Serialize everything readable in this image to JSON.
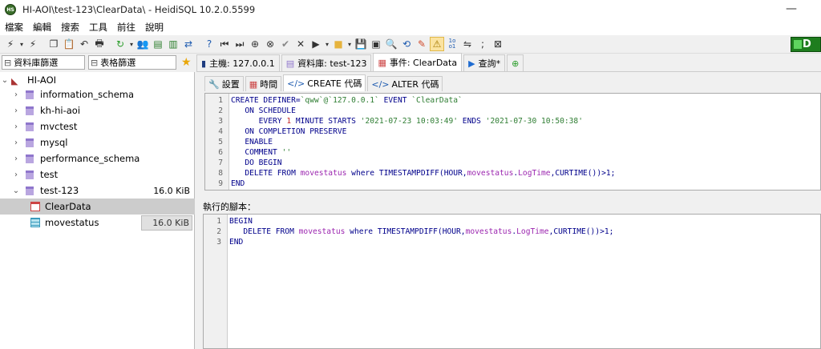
{
  "window": {
    "title": "HI-AOI\\test-123\\ClearData\\ - HeidiSQL 10.2.0.5599",
    "minimize": "—"
  },
  "menu": [
    "檔案",
    "編輯",
    "搜索",
    "工具",
    "前往",
    "說明"
  ],
  "toolbar": {
    "run_label": "D"
  },
  "filters": {
    "db_filter": "資料庫篩選",
    "table_filter": "表格篩選"
  },
  "tabs": [
    {
      "label": "主機: 127.0.0.1"
    },
    {
      "label": "資料庫: test-123"
    },
    {
      "label": "事件: ClearData"
    },
    {
      "label": "查詢*"
    }
  ],
  "tree": {
    "root": "HI-AOI",
    "databases": [
      "information_schema",
      "kh-hi-aoi",
      "mvctest",
      "mysql",
      "performance_schema",
      "test"
    ],
    "current_db": {
      "name": "test-123",
      "size": "16.0 KiB"
    },
    "items": [
      {
        "name": "ClearData",
        "type": "event",
        "size": ""
      },
      {
        "name": "movestatus",
        "type": "table",
        "size": "16.0 KiB"
      }
    ]
  },
  "subtabs": [
    "設置",
    "時間",
    "CREATE 代碼",
    "ALTER 代碼"
  ],
  "create_code": {
    "line_numbers": [
      "1",
      "2",
      "3",
      "4",
      "5",
      "6",
      "7",
      "8",
      "9"
    ],
    "lines": [
      {
        "a": "CREATE DEFINER=",
        "b": "`qww`@`127.0.0.1`",
        "c": " EVENT ",
        "d": "`ClearData`"
      },
      {
        "a": "   ON SCHEDULE"
      },
      {
        "a": "      EVERY ",
        "n": "1",
        "b": " MINUTE STARTS ",
        "s1": "'2021-07-23 10:03:49'",
        "c": " ENDS ",
        "s2": "'2021-07-30 10:50:38'"
      },
      {
        "a": "   ON COMPLETION PRESERVE"
      },
      {
        "a": "   ENABLE"
      },
      {
        "a": "   COMMENT ",
        "s1": "''"
      },
      {
        "a": "   DO BEGIN"
      },
      {
        "a": "   DELETE FROM ",
        "id1": "movestatus",
        "b": " where TIMESTAMPDIFF(HOUR,",
        "id2": "movestatus",
        "c": ".",
        "id3": "LogTime",
        "d": ",CURTIME())>1;"
      },
      {
        "a": "END"
      }
    ]
  },
  "sql_label": "執行的腳本：",
  "exec_code": {
    "line_numbers": [
      "1",
      "2",
      "3"
    ],
    "lines": [
      {
        "a": "BEGIN"
      },
      {
        "a": "   DELETE FROM ",
        "id1": "movestatus",
        "b": " where TIMESTAMPDIFF(HOUR,",
        "id2": "movestatus",
        "c": ".",
        "id3": "LogTime",
        "d": ",CURTIME())>1;"
      },
      {
        "a": "END"
      }
    ]
  }
}
